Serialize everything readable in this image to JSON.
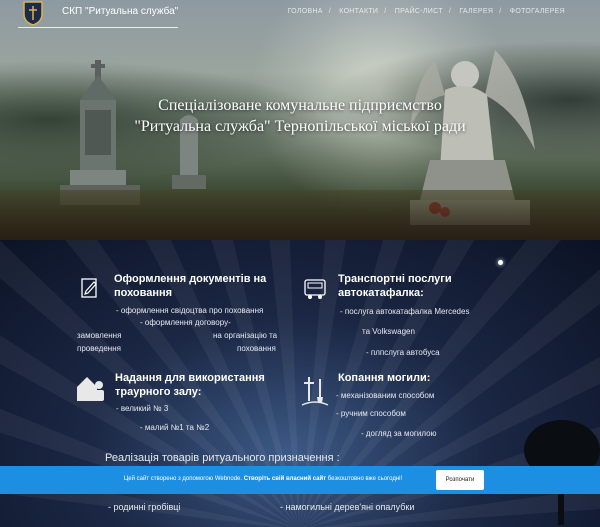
{
  "header": {
    "logo_text": "СКП \"Ритуальна служба\"",
    "nav": [
      {
        "label": "ГОЛОВНА"
      },
      {
        "label": "КОНТАКТИ"
      },
      {
        "label": "ПРАЙС-ЛИСТ"
      },
      {
        "label": "ГАЛЕРЕЯ"
      },
      {
        "label": "ФОТОГАЛЕРЕЯ"
      }
    ],
    "nav_separator": "/"
  },
  "hero": {
    "title_line1": "Спеціалізоване комунальне підприємство",
    "title_line2": "\"Ритуальна служба\" Тернопільської міської ради"
  },
  "services": {
    "documents": {
      "icon": "document-pen-icon",
      "title_line1": "Оформлення документів на",
      "title_line2": "поховання",
      "items": [
        "- оформлення свідоцтва про поховання",
        "- оформлення договору-",
        "замовлення",
        "на організацію та",
        "проведення",
        "поховання"
      ]
    },
    "transport": {
      "icon": "bus-icon",
      "title_line1": "Транспортні послуги",
      "title_line2": "автокатафалка:",
      "items": [
        "- послуга автокатафалка Mercedes",
        "та Volkswagen",
        "- плпслуга автобуса"
      ]
    },
    "hall": {
      "icon": "house-people-icon",
      "title_line1": "Надання для використання",
      "title_line2": "траурного залу:",
      "items": [
        "- великий № 3",
        "- малий №1 та №2"
      ]
    },
    "grave": {
      "icon": "shovel-cross-icon",
      "title": "Копання могили:",
      "items": [
        "- механізованим способом",
        "- ручним способом",
        "- догляд за могилою"
      ]
    }
  },
  "sale": {
    "title": "Реалізація товарів ритуального призначення :",
    "items": [
      "- родинні гробівці",
      "- намогильні дерев'яні опалубки"
    ]
  },
  "banner": {
    "text_normal": "Цей сайт створено з допомогою Webnode.",
    "text_bold": "Створіть свій власний сайт",
    "text_end": "безкоштовно вже сьогодні!",
    "button": "Розпочати",
    "color": "#1d8fe3"
  }
}
